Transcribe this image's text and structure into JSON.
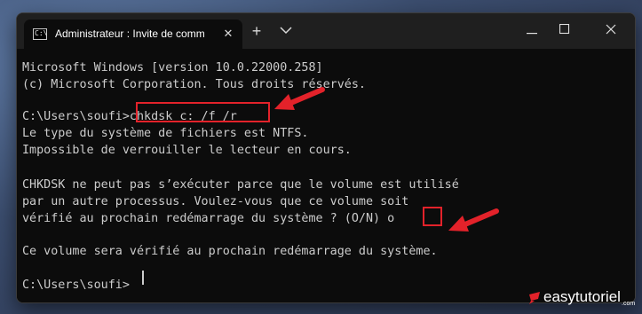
{
  "window": {
    "tab_title": "Administrateur : Invite de comm",
    "tab_icon_text": "C:\\",
    "controls": {
      "close_tab": "✕",
      "new_tab": "+",
      "dropdown": "⌄",
      "minimize": "—",
      "maximize": "☐",
      "close": "✕"
    }
  },
  "console": {
    "lines": [
      "Microsoft Windows [version 10.0.22000.258]",
      "(c) Microsoft Corporation. Tous droits réservés.",
      "",
      "C:\\Users\\soufi>chkdsk c: /f /r",
      "Le type du système de fichiers est NTFS.",
      "Impossible de verrouiller le lecteur en cours.",
      "",
      "CHKDSK ne peut pas s’exécuter parce que le volume est utilisé",
      "par un autre processus. Voulez-vous que ce volume soit",
      "vérifié au prochain redémarrage du système ? (O/N) o",
      "",
      "Ce volume sera vérifié au prochain redémarrage du système.",
      "",
      "C:\\Users\\soufi>"
    ]
  },
  "watermark": {
    "brand": "easytutoriel",
    "suffix": ".com"
  },
  "colors": {
    "terminal_bg": "#0c0c0c",
    "terminal_text": "#cccccc",
    "highlight": "#e3222a",
    "titlebar": "#1f1f1f"
  }
}
